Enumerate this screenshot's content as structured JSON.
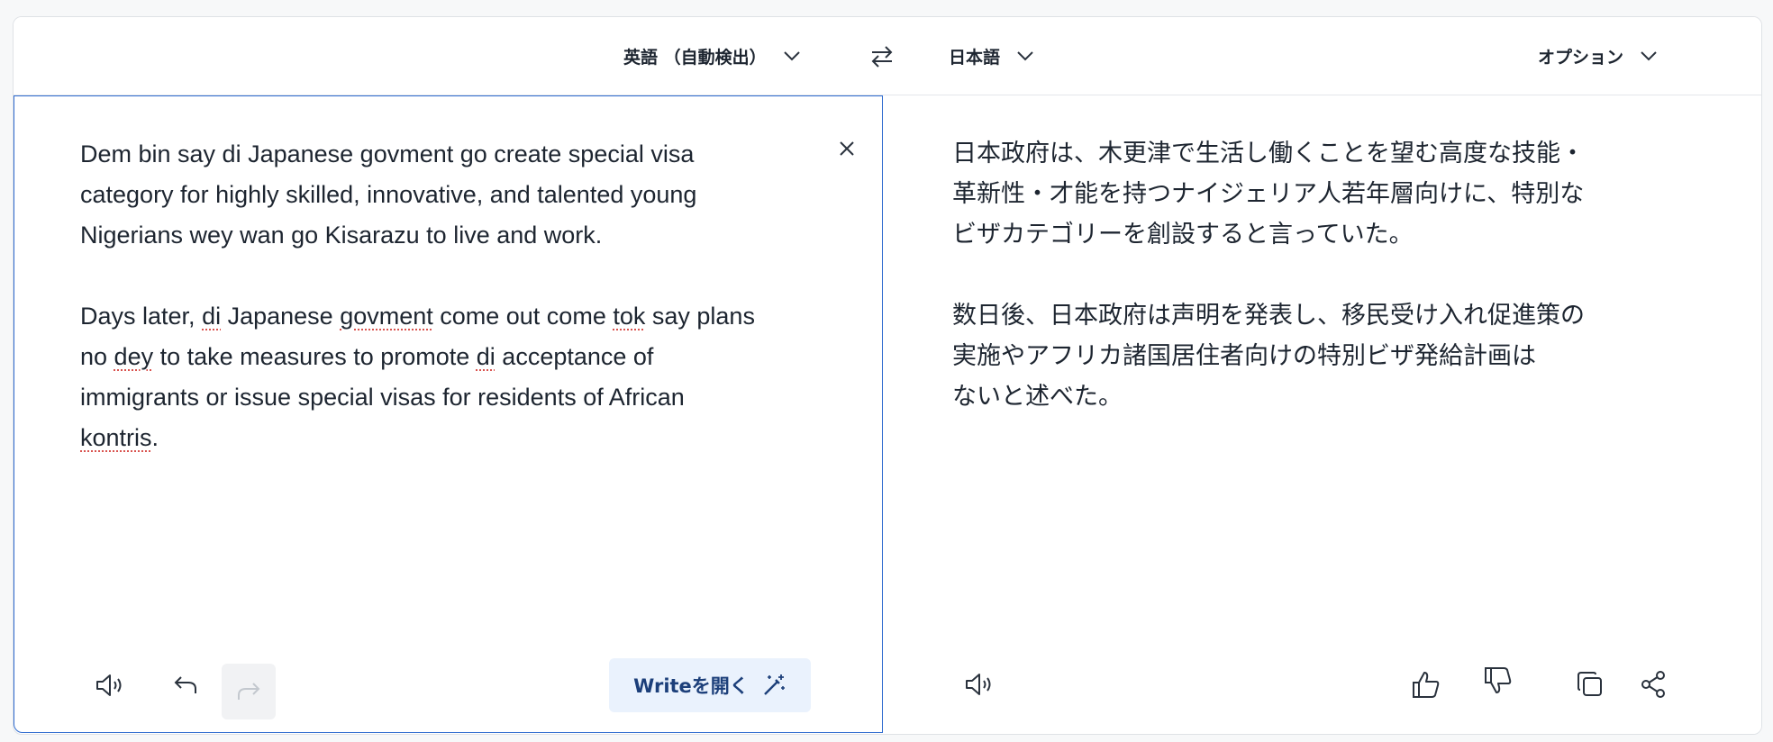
{
  "header": {
    "source_lang": "英語 （自動検出）",
    "target_lang": "日本語",
    "options_label": "オプション"
  },
  "source": {
    "paragraphs": [
      [
        {
          "t": "Dem bin say di Japanese govment go create special visa category for highly skilled, innovative, and talented young Nigerians wey wan go Kisarazu to live and work."
        }
      ],
      [
        {
          "t": "Days later, "
        },
        {
          "t": "di",
          "err": true
        },
        {
          "t": " Japanese "
        },
        {
          "t": "govment",
          "err": true
        },
        {
          "t": " come out come "
        },
        {
          "t": "tok",
          "err": true
        },
        {
          "t": " say plans no "
        },
        {
          "t": "dey",
          "err": true
        },
        {
          "t": " to take measures to promote "
        },
        {
          "t": "di",
          "err": true
        },
        {
          "t": " acceptance of immigrants or issue special visas for residents of African "
        },
        {
          "t": "kontris",
          "err": true
        },
        {
          "t": "."
        }
      ]
    ],
    "write_button_label": "Writeを開く"
  },
  "target": {
    "paragraphs": [
      [
        "日本政府は、木更津で生活し働くことを望む高度な技能・",
        "革新性・才能を持つナイジェリア人若年層向けに、特別な",
        "ビザカテゴリーを創設すると言っていた。"
      ],
      [
        "数日後、日本政府は声明を発表し、移民受け入れ促進策の",
        "実施やアフリカ諸国居住者向けの特別ビザ発給計画は",
        "ないと述べた。"
      ]
    ]
  },
  "icons": {
    "source_chevron": "chevron-down-icon",
    "target_chevron": "chevron-down-icon",
    "options_chevron": "chevron-down-icon",
    "swap": "swap-arrows-icon",
    "clear": "close-icon",
    "listen_source": "speaker-icon",
    "undo": "undo-icon",
    "redo": "redo-icon",
    "write_wand": "magic-wand-icon",
    "listen_target": "speaker-icon",
    "thumbs_up": "thumbs-up-icon",
    "thumbs_down": "thumbs-down-icon",
    "copy": "copy-icon",
    "share": "share-icon"
  },
  "colors": {
    "accent_border": "#2f6bcf",
    "text": "#1d2530",
    "spell_error": "#d9534f",
    "write_button_bg": "#eaf2fd",
    "write_button_text": "#1c3f7a"
  }
}
